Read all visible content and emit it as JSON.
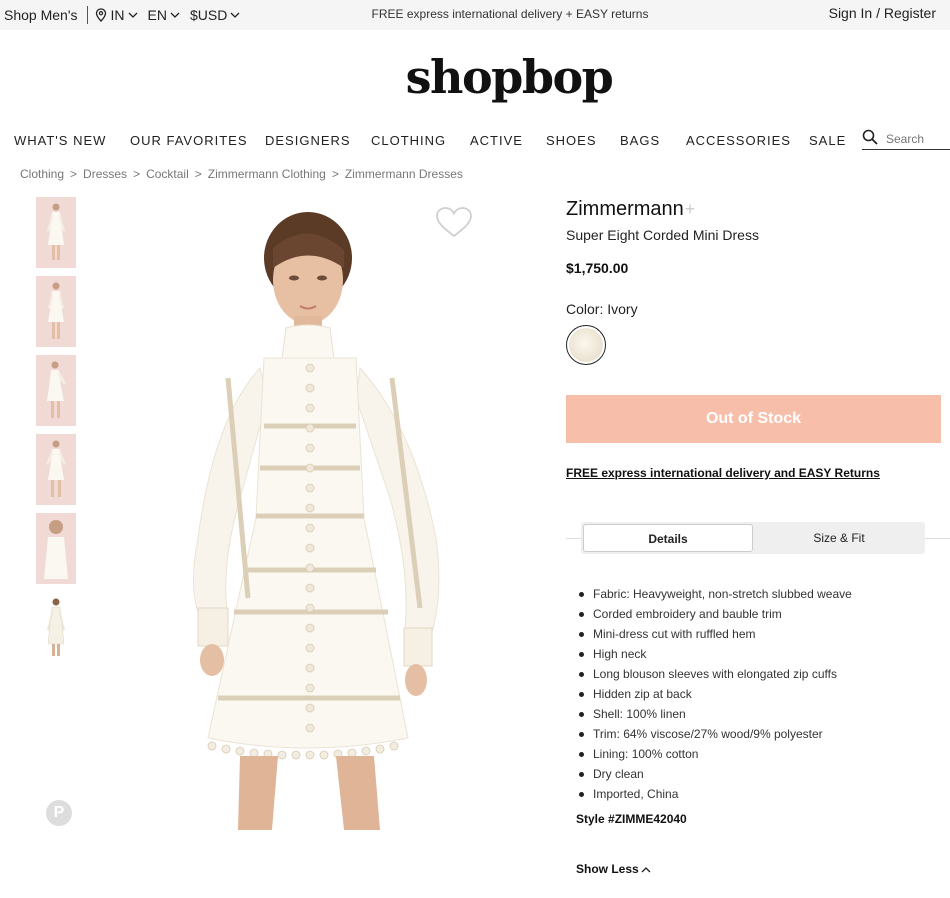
{
  "topbar": {
    "shop_mens": "Shop Men's",
    "country": "IN",
    "language": "EN",
    "currency": "$USD",
    "promo": "FREE express international delivery + EASY returns",
    "signin": "Sign In / Register"
  },
  "logo": "shopbop",
  "nav": {
    "items": [
      "WHAT'S NEW",
      "OUR FAVORITES",
      "DESIGNERS",
      "CLOTHING",
      "ACTIVE",
      "SHOES",
      "BAGS",
      "ACCESSORIES",
      "SALE"
    ],
    "search_placeholder": "Search"
  },
  "breadcrumb": [
    "Clothing",
    "Dresses",
    "Cocktail",
    "Zimmermann Clothing",
    "Zimmermann Dresses"
  ],
  "product": {
    "brand": "Zimmermann",
    "name": "Super Eight Corded Mini Dress",
    "price": "$1,750.00",
    "color_label": "Color: Ivory",
    "swatch_color": "#f3ede1",
    "status_button": "Out of Stock",
    "status_color": "#f7bfa9",
    "delivery_link": "FREE express international delivery and EASY Returns"
  },
  "tabs": [
    "Details",
    "Size & Fit"
  ],
  "details": [
    "Fabric: Heavyweight, non-stretch slubbed weave",
    "Corded embroidery and bauble trim",
    "Mini-dress cut with ruffled hem",
    "High neck",
    "Long blouson sleeves with elongated zip cuffs",
    "Hidden zip at back",
    "Shell: 100% linen",
    "Trim: 64% viscose/27% wood/9% polyester",
    "Lining: 100% cotton",
    "Dry clean",
    "Imported, China"
  ],
  "style_number": "Style #ZIMME42040",
  "show_less": "Show Less",
  "icons": {
    "location": "location-pin-icon",
    "chevron": "chevron-down-icon",
    "search": "search-icon",
    "heart": "heart-icon",
    "pinterest": "pinterest-icon",
    "chevron_up": "chevron-up-icon"
  }
}
